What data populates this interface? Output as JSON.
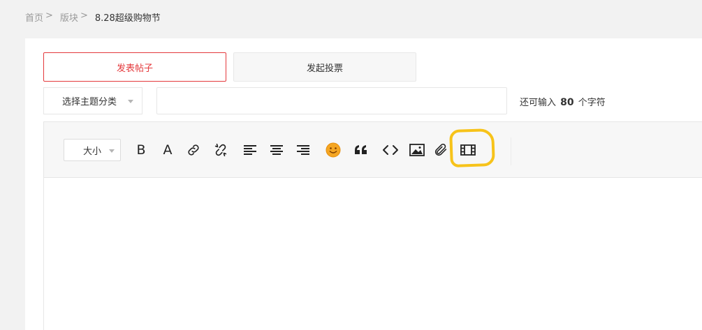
{
  "breadcrumb": {
    "items": [
      "首页",
      "版块"
    ],
    "separator": ">",
    "current": "8.28超级购物节"
  },
  "tabs": {
    "post": "发表帖子",
    "vote": "发起投票"
  },
  "form": {
    "topic_select": "选择主题分类",
    "title_value": "",
    "char_prefix": "还可输入",
    "char_count": "80",
    "char_suffix": "个字符"
  },
  "toolbar": {
    "size_select": "大小",
    "bold": "B",
    "font_color": "A"
  },
  "colors": {
    "accent": "#e4393c",
    "highlight": "#f7c31a",
    "smiley": "#f5a623"
  }
}
